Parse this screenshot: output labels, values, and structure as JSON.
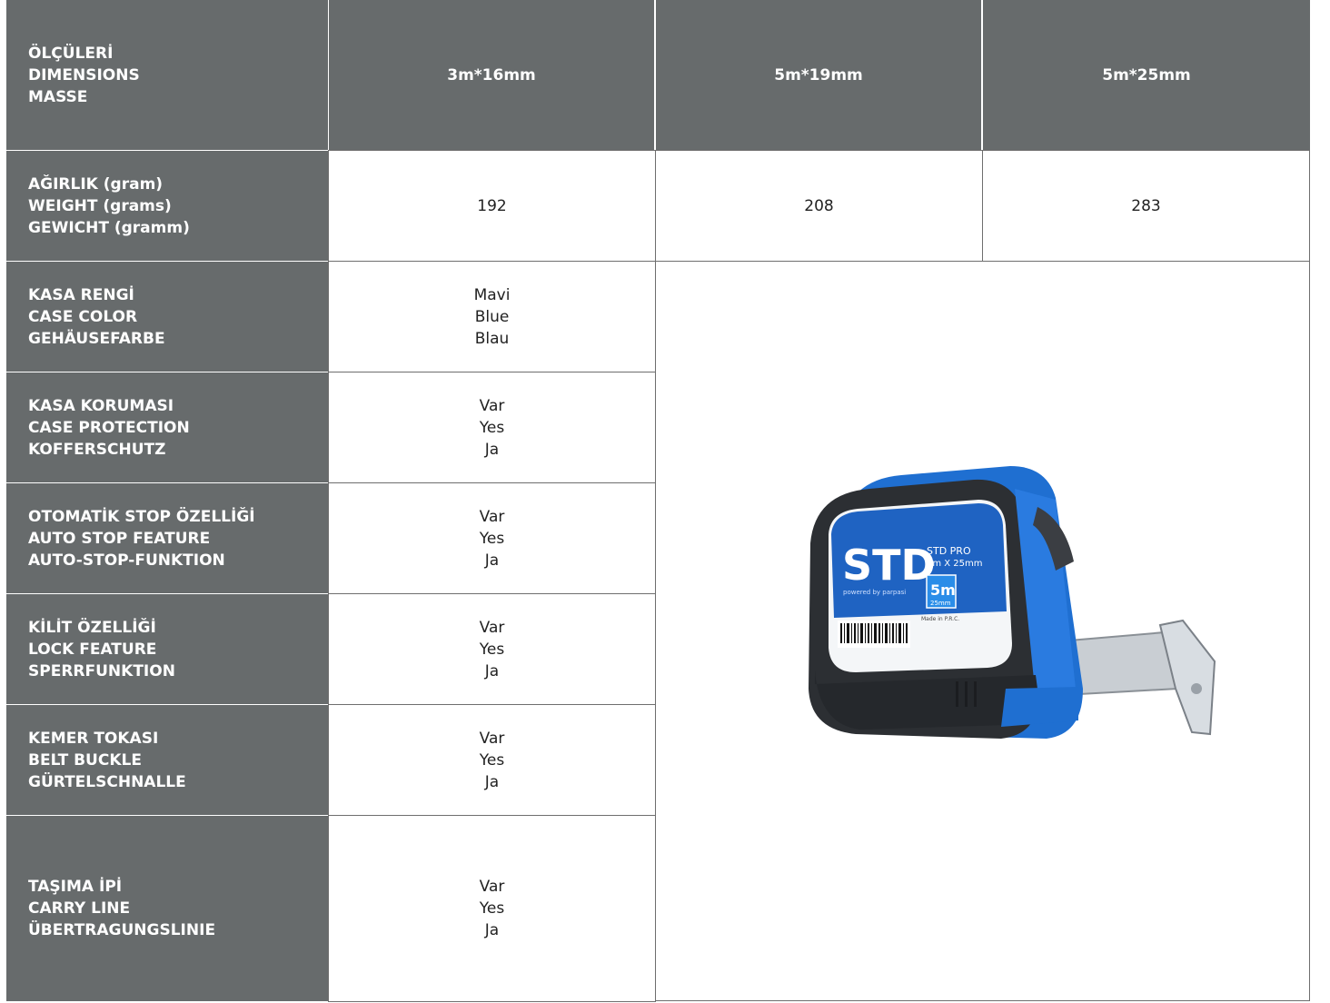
{
  "header": {
    "dimensions_label": [
      "ÖLÇÜLERİ",
      "DIMENSIONS",
      "MASSE"
    ],
    "sizes": [
      "3m*16mm",
      "5m*19mm",
      "5m*25mm"
    ]
  },
  "weight": {
    "label": [
      "AĞIRLIK (gram)",
      "WEIGHT (grams)",
      "GEWICHT (gramm)"
    ],
    "values": [
      "192",
      "208",
      "283"
    ]
  },
  "features": [
    {
      "label": [
        "KASA RENGİ",
        "CASE COLOR",
        "GEHÄUSEFARBE"
      ],
      "value": [
        "Mavi",
        "Blue",
        "Blau"
      ]
    },
    {
      "label": [
        "KASA KORUMASI",
        "CASE PROTECTION",
        "KOFFERSCHUTZ"
      ],
      "value": [
        "Var",
        "Yes",
        "Ja"
      ]
    },
    {
      "label": [
        "OTOMATİK STOP ÖZELLİĞİ",
        "AUTO STOP FEATURE",
        "AUTO-STOP-FUNKTION"
      ],
      "value": [
        "Var",
        "Yes",
        "Ja"
      ]
    },
    {
      "label": [
        "KİLİT ÖZELLİĞİ",
        "LOCK FEATURE",
        "SPERRFUNKTION"
      ],
      "value": [
        "Var",
        "Yes",
        "Ja"
      ]
    },
    {
      "label": [
        "KEMER TOKASI",
        "BELT BUCKLE",
        "GÜRTELSCHNALLE"
      ],
      "value": [
        "Var",
        "Yes",
        "Ja"
      ]
    },
    {
      "label": [
        "TAŞIMA İPİ",
        "CARRY LINE",
        "ÜBERTRAGUNGSLINIE"
      ],
      "value": [
        "Var",
        "Yes",
        "Ja"
      ]
    }
  ],
  "product_image": {
    "brand": "STD",
    "model": "STD PRO",
    "size_text": "5m X 25mm",
    "badge_big": "5m",
    "badge_small": "25mm",
    "made_in": "Made in P.R.C.",
    "tagline": "powered by parpasi",
    "colors": {
      "case_blue": "#1f6fd1",
      "rubber": "#2c2f33",
      "label_white": "#f4f6f8"
    }
  },
  "colors": {
    "header_bg": "#676b6c",
    "border": "#6e6e6e"
  }
}
